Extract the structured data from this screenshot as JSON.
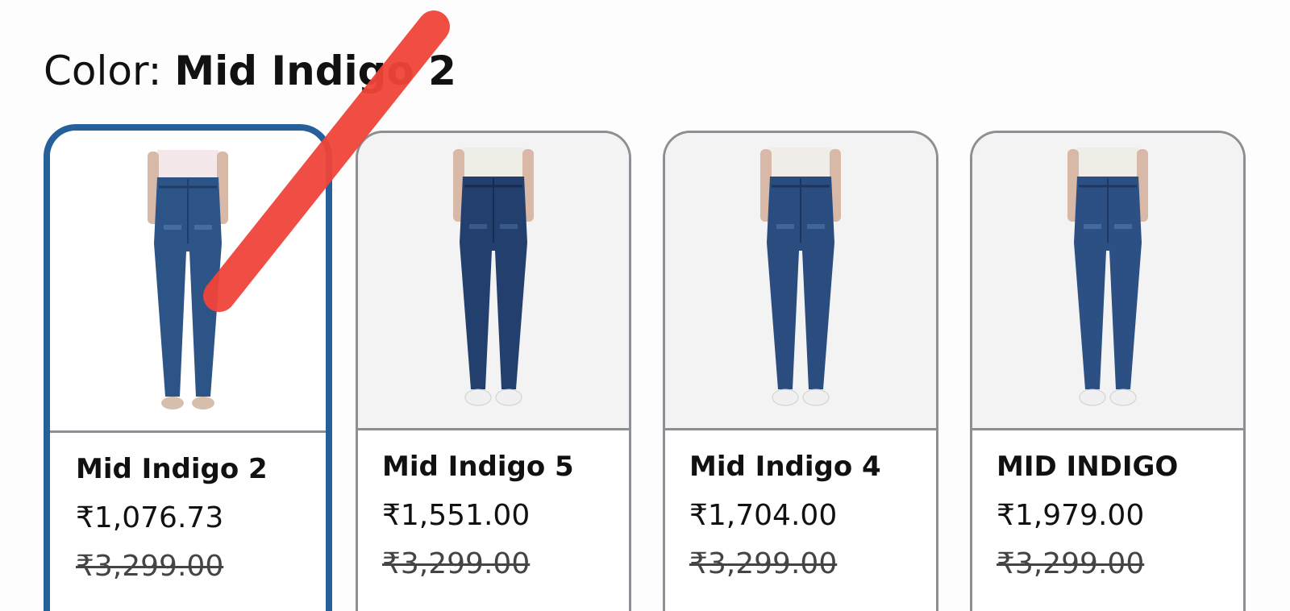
{
  "color_selector": {
    "prefix": "Color: ",
    "selected_value": "Mid Indigo 2"
  },
  "swatches": [
    {
      "name": "Mid Indigo 2",
      "price": "₹1,076.73",
      "list_price": "₹3,299.00",
      "selected": true
    },
    {
      "name": "Mid Indigo 5",
      "price": "₹1,551.00",
      "list_price": "₹3,299.00",
      "selected": false
    },
    {
      "name": "Mid Indigo 4",
      "price": "₹1,704.00",
      "list_price": "₹3,299.00",
      "selected": false
    },
    {
      "name": "MID INDIGO",
      "price": "₹1,979.00",
      "list_price": "₹3,299.00",
      "selected": false
    }
  ],
  "colors": {
    "selected_border": "#25609b",
    "card_border": "#8c8f93",
    "annotation_stroke": "#f0443a",
    "denim": "#2d5487"
  }
}
